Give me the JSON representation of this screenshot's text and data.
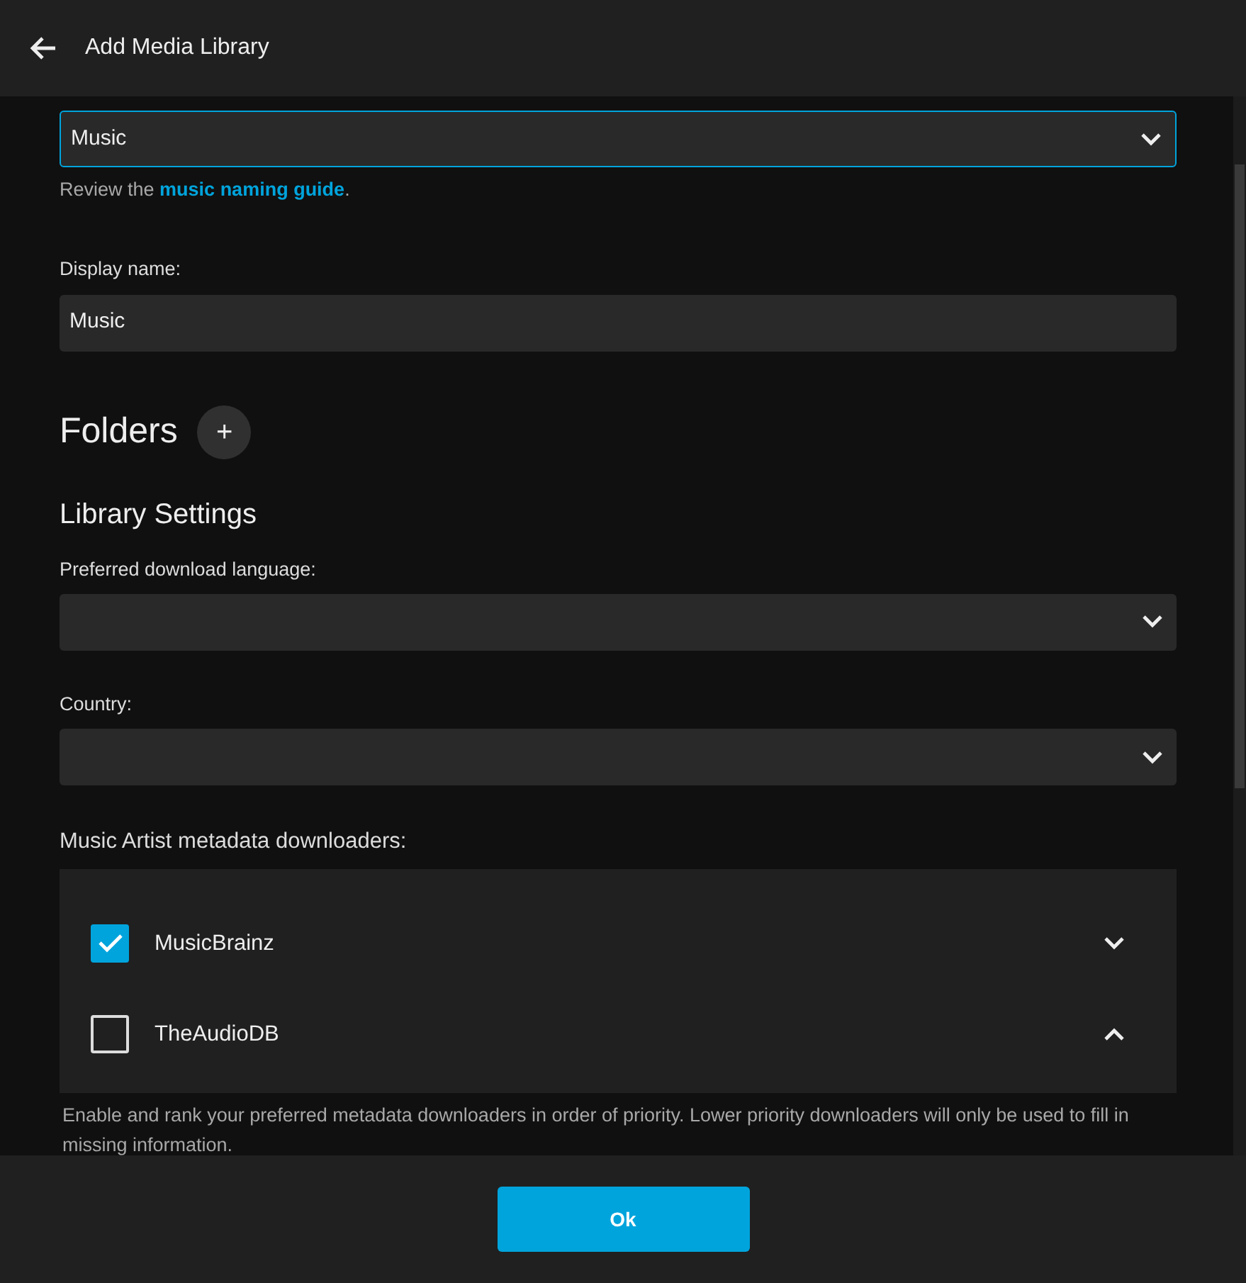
{
  "header": {
    "title": "Add Media Library"
  },
  "content_type": {
    "value": "Music",
    "help_before": "Review the ",
    "link": "music naming guide",
    "help_after": "."
  },
  "display_name": {
    "label": "Display name:",
    "value": "Music"
  },
  "folders": {
    "title": "Folders",
    "add_button": "+"
  },
  "library_settings": {
    "title": "Library Settings",
    "fields": [
      {
        "label": "Preferred download language:"
      },
      {
        "label": "Country:"
      }
    ]
  },
  "downloaders": {
    "label": "Music Artist metadata downloaders:",
    "items": [
      {
        "name": "MusicBrainz",
        "checked": true,
        "expanded": false
      },
      {
        "name": "TheAudioDB",
        "checked": false,
        "expanded": true
      }
    ],
    "help": "Enable and rank your preferred metadata downloaders in order of priority. Lower priority downloaders will only be used to fill in missing information."
  },
  "footer": {
    "button": "Ok"
  }
}
